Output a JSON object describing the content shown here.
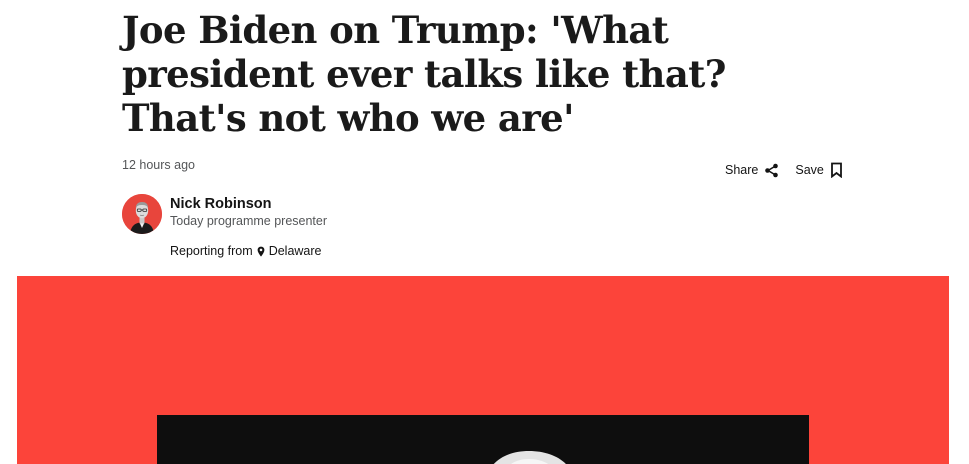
{
  "article": {
    "headline": "Joe Biden on Trump: 'What president ever talks like that? That's not who we are'",
    "timestamp": "12 hours ago"
  },
  "actions": {
    "share_label": "Share",
    "share_icon": "share-icon",
    "save_label": "Save",
    "save_icon": "bookmark-icon"
  },
  "byline": {
    "author_name": "Nick Robinson",
    "author_role": "Today programme presenter",
    "avatar_icon": "author-avatar",
    "location_prefix": "Reporting from",
    "location_icon": "location-pin-icon",
    "location": "Delaware"
  },
  "hero": {
    "background_color": "#fc443a",
    "photo_color": "#0e0e0e"
  }
}
